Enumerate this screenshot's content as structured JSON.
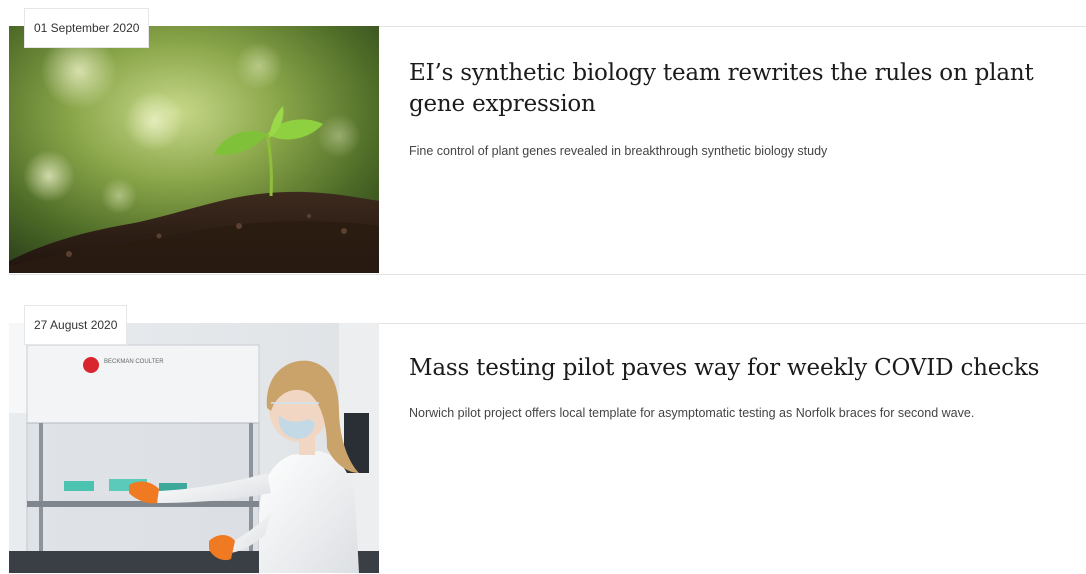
{
  "articles": [
    {
      "date": "01 September 2020",
      "title": "EI’s synthetic biology team rewrites the rules on plant gene expression",
      "summary": "Fine control of plant genes revealed in breakthrough synthetic biology study",
      "image": "seedling-in-soil-image"
    },
    {
      "date": "27 August 2020",
      "title": "Mass testing pilot paves way for weekly COVID checks",
      "summary": "Norwich pilot project offers local template for asymptomatic testing as Norfolk braces for second wave.",
      "image": "lab-scientist-image",
      "image_text": "BECKMAN COULTER"
    }
  ]
}
